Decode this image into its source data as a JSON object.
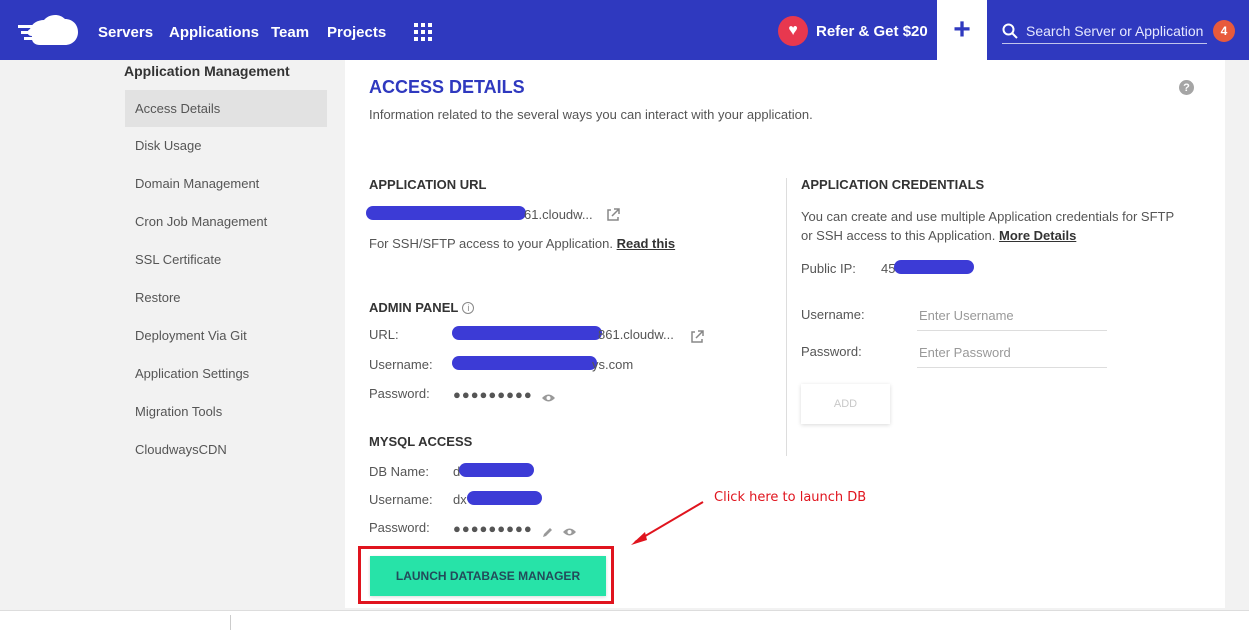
{
  "nav": {
    "items": [
      "Servers",
      "Applications",
      "Team",
      "Projects"
    ],
    "refer_label": "Refer & Get $20",
    "plus_label": "+",
    "search_placeholder": "Search Server or Application",
    "notification_count": "4"
  },
  "sidebar": {
    "title": "Application Management",
    "items": [
      "Access Details",
      "Disk Usage",
      "Domain Management",
      "Cron Job Management",
      "SSL Certificate",
      "Restore",
      "Deployment Via Git",
      "Application Settings",
      "Migration Tools",
      "CloudwaysCDN"
    ],
    "active": "Access Details"
  },
  "main": {
    "title": "ACCESS DETAILS",
    "description": "Information related to the several ways you can interact with your application.",
    "help": "?",
    "app_url": {
      "title": "APPLICATION URL",
      "value_suffix": "61.cloudw...",
      "ssh_text": "For SSH/SFTP access to your Application.",
      "read_this": "Read this"
    },
    "admin_panel": {
      "title": "ADMIN PANEL",
      "url_label": "URL:",
      "url_suffix": "861.cloudw...",
      "username_label": "Username:",
      "username_suffix": "ys.com",
      "password_label": "Password:",
      "password_mask": "●●●●●●●●●"
    },
    "mysql": {
      "title": "MYSQL ACCESS",
      "db_label": "DB Name:",
      "db_prefix": "d",
      "username_label": "Username:",
      "username_prefix": "dx",
      "password_label": "Password:",
      "password_mask": "●●●●●●●●●",
      "launch_label": "LAUNCH DATABASE MANAGER"
    },
    "credentials": {
      "title": "APPLICATION CREDENTIALS",
      "description_line1": "You can create and use multiple Application credentials for SFTP",
      "description_line2": "or SSH access to this Application.",
      "more_details": "More Details",
      "public_ip_label": "Public IP:",
      "public_ip_prefix": "45",
      "username_label": "Username:",
      "username_placeholder": "Enter Username",
      "password_label": "Password:",
      "password_placeholder": "Enter Password",
      "add_label": "ADD"
    }
  },
  "annotation": {
    "text": "Click here to launch DB"
  },
  "colors": {
    "brand": "#2f39bf",
    "launch": "#27e3a8",
    "annotation": "#e0141e",
    "badge": "#e85a3c"
  }
}
